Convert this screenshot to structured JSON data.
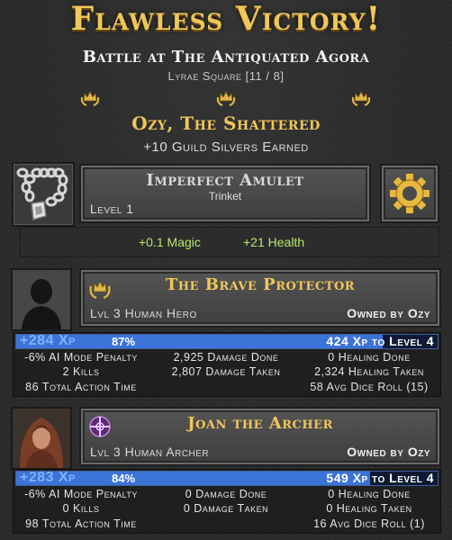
{
  "header": {
    "title": "Flawless Victory!",
    "battle": "Battle at The Antiquated Agora",
    "location": "Lyrae Square [11 / 8]",
    "champion": "Ozy, The Shattered",
    "reward": "+10 Guild Silvers Earned"
  },
  "item": {
    "icon": "amulet-chain-icon",
    "name": "Imperfect Amulet",
    "type": "Trinket",
    "level": "Level 1",
    "bonus_magic": "+0.1 Magic",
    "bonus_health": "+21 Health",
    "action_icon": "gear-icon"
  },
  "heroes": [
    {
      "portrait": "silhouette-portrait",
      "badge_icon": "crown-laurel-icon",
      "name": "The Brave Protector",
      "class_line": "Lvl 3 Human Hero",
      "owner": "Owned by Ozy",
      "xp_gain": "+284 Xp",
      "xp_percent_label": "87%",
      "xp_fraction": 0.87,
      "xp_next": "424 Xp to Level 4",
      "stats": {
        "penalty": "-6% AI Mode Penalty",
        "kills": "2 Kills",
        "action_time": "86 Total Action Time",
        "damage_done": "2,925 Damage Done",
        "damage_taken": "2,807 Damage Taken",
        "healing_done": "0 Healing Done",
        "healing_taken": "2,324 Healing Taken",
        "dice": "58 Avg Dice Roll (15)"
      }
    },
    {
      "portrait": "archer-portrait",
      "badge_icon": "crosshair-emblem-icon",
      "name": "Joan the Archer",
      "class_line": "Lvl 3 Human Archer",
      "owner": "Owned by Ozy",
      "xp_gain": "+283 Xp",
      "xp_percent_label": "84%",
      "xp_fraction": 0.84,
      "xp_next": "549 Xp to Level 4",
      "stats": {
        "penalty": "-6% AI Mode Penalty",
        "kills": "0 Kills",
        "action_time": "98 Total Action Time",
        "damage_done": "0 Damage Done",
        "damage_taken": "0 Damage Taken",
        "healing_done": "0 Healing Done",
        "healing_taken": "0 Healing Taken",
        "dice": "16 Avg Dice Roll (1)"
      }
    }
  ],
  "colors": {
    "gold": "#f0c75a",
    "xp_blue": "#3c73d6",
    "bonus_green": "#b8e86a"
  }
}
